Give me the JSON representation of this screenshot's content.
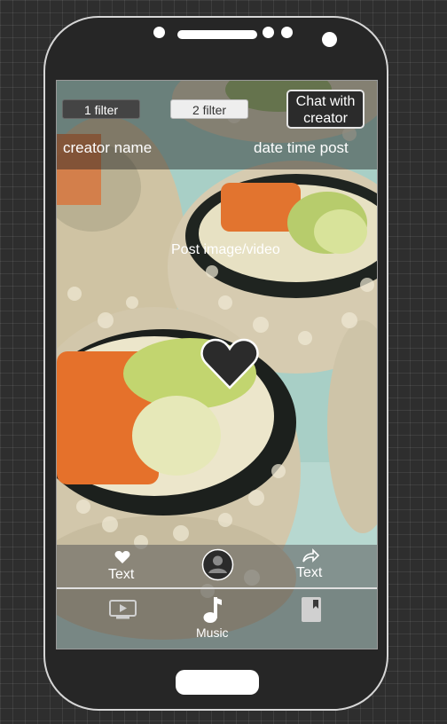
{
  "filters": {
    "filter1_label": "1 filter",
    "filter2_label": "2 filter"
  },
  "chat_button_label": "Chat with creator",
  "post": {
    "creator_name": "creator name",
    "date_time": "date time post",
    "media_label": "Post image/video"
  },
  "actions": {
    "like_label": "Text",
    "share_label": "Text"
  },
  "nav": {
    "music_label": "Music"
  },
  "icons": [
    "heart-icon",
    "avatar-icon",
    "share-icon",
    "video-icon",
    "music-note-icon",
    "bookmark-icon"
  ]
}
